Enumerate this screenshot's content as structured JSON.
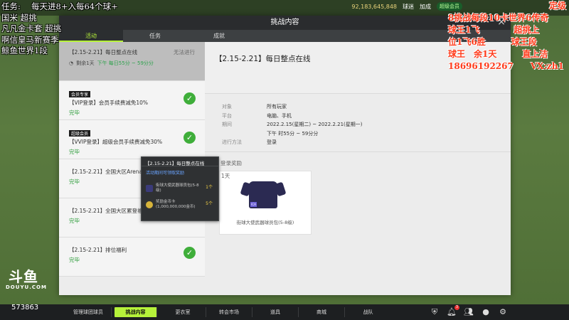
{
  "overlay_left": {
    "lines": [
      "任务:　 每天进8+入每64个球+",
      "国米 超挑",
      "凡凡金卡套 超挑",
      "啊信皇马新赛季",
      "鲸鱼世界1段"
    ]
  },
  "overlay_right": {
    "lines": [
      "定级",
      "8挑战每段10卡世界6传奇",
      "球王1飞　　　　超挑上",
      "位1飞6胜　　　球王段",
      "球王　余1天　　　直上洁",
      "18696192267　　VX:zh1"
    ]
  },
  "topbar": {
    "coins": "92,183,645,848",
    "tag1": "球迷",
    "tag2": "加成",
    "badge": "超级会员"
  },
  "logo": {
    "main": "斗鱼",
    "sub": "DOUYU.COM"
  },
  "room_number": "573863",
  "modal": {
    "title": "挑战内容",
    "close": "×",
    "tabs": [
      "活动",
      "任务",
      "成就"
    ]
  },
  "list": [
    {
      "title": "【2.15-2.21】每日整点在线",
      "right_status": "无法进行",
      "sub_prefix": "剩余1天",
      "sub_highlight": "下午 每日55分 ~ 59分分",
      "selected": true
    },
    {
      "tag": "会员专享",
      "title": "【VIP登录】会员手续费减免10%",
      "status": "完毕",
      "done": true
    },
    {
      "tag": "超级会员",
      "title": "【VVIP登录】超级会员手续费减免30%",
      "status": "完毕",
      "done": true
    },
    {
      "title": "【2.15-2.21】全国大区Arena胜场活",
      "status": "完毕",
      "done": false
    },
    {
      "title": "【2.15-2.21】全国大区累登福利登I",
      "status": "完毕",
      "done": false
    },
    {
      "title": "【2.15-2.21】排位福利",
      "status": "完毕",
      "done": true
    }
  ],
  "detail": {
    "title": "【2.15-2.21】每日整点在线",
    "info": [
      {
        "key": "对象",
        "val": "所有玩家"
      },
      {
        "key": "平台",
        "val": "电脑、手机"
      },
      {
        "key": "期间",
        "val": "2022.2.15(星期二) ~ 2022.2.21(星期一)"
      },
      {
        "key": "",
        "val": "下午 时55分 ~ 59分分"
      },
      {
        "key": "进行方法",
        "val": "登录"
      }
    ],
    "reward_label": "登录奖励",
    "day_label": "1天",
    "reward_name": "街球大使武器球员包(5-8级)",
    "jersey_badge": "ICA"
  },
  "tooltip": {
    "title": "【2.15-2.21】每日整点在线",
    "sub": "活动期间可领取奖励",
    "rows": [
      {
        "text": "街球大使武器球员包(5-8级)",
        "count": "1个",
        "icon_color": "#3b3b7a"
      },
      {
        "text": "奖励金币卡(1,000,000,000金币)",
        "count": "5个",
        "icon_color": "#d6b33a"
      }
    ]
  },
  "bottom_nav": [
    "管理球团球员",
    "挑战内容",
    "更衣室",
    "转会市场",
    "道具",
    "商城",
    "战队"
  ],
  "bottom_icons": [
    "shield-icon",
    "bell-icon",
    "people-icon",
    "user-icon",
    "gear-icon"
  ],
  "notification_count": "3"
}
